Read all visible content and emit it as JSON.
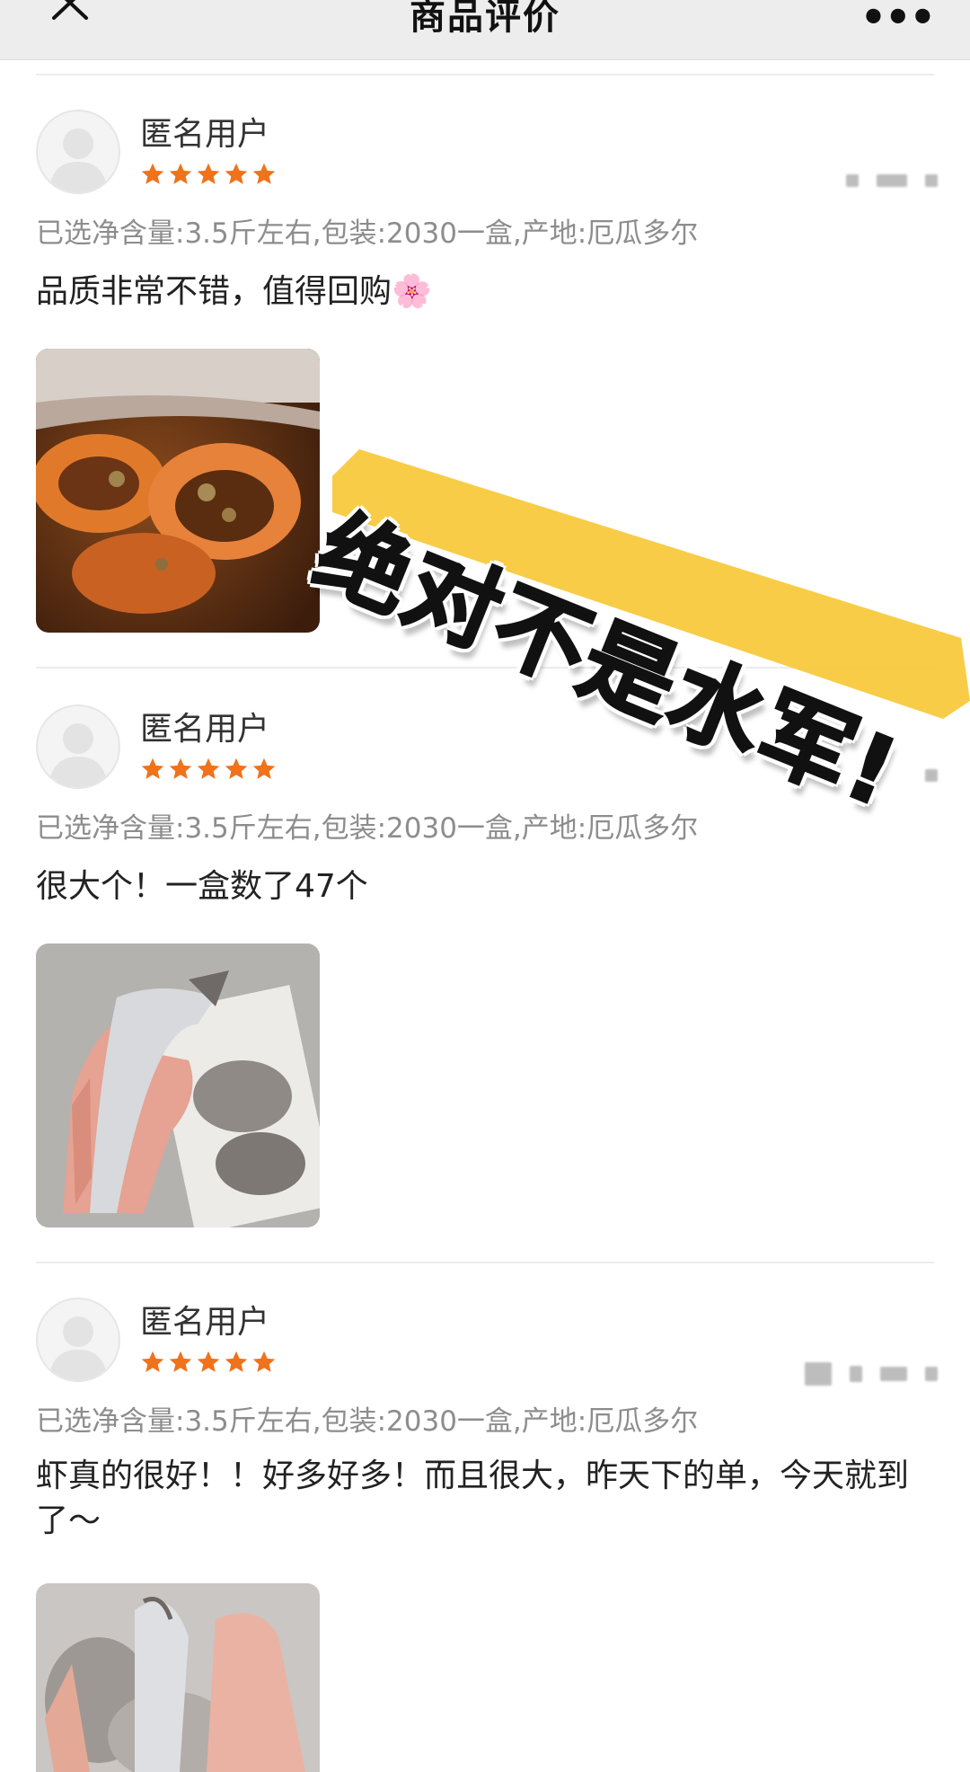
{
  "header": {
    "title": "商品评价",
    "more": "•••"
  },
  "reviews": [
    {
      "user": "匿名用户",
      "rating": 5,
      "spec": "已选净含量:3.5斤左右,包装:2030一盒,产地:厄瓜多尔",
      "comment": "品质非常不错，值得回购🌸"
    },
    {
      "user": "匿名用户",
      "rating": 5,
      "spec": "已选净含量:3.5斤左右,包装:2030一盒,产地:厄瓜多尔",
      "comment": "很大个！一盒数了47个"
    },
    {
      "user": "匿名用户",
      "rating": 5,
      "spec": "已选净含量:3.5斤左右,包装:2030一盒,产地:厄瓜多尔",
      "comment": "虾真的很好！！好多好多！而且很大，昨天下的单，今天就到了～"
    }
  ],
  "overlay": {
    "text": "绝对不是水军!",
    "highlight_color": "#f8c93c"
  },
  "colors": {
    "star": "#f0721a",
    "spec_text": "#8d8d8d",
    "topbar_bg": "#ededed"
  },
  "icons": {
    "close": "close-icon",
    "more": "more-icon",
    "avatar": "user-avatar-icon",
    "star": "star-icon"
  }
}
